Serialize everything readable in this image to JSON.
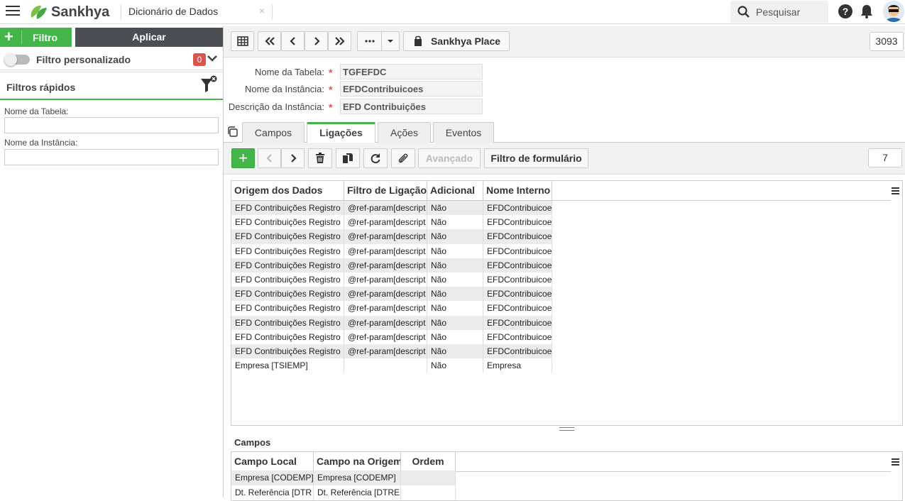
{
  "header": {
    "brand": "Sankhya",
    "title": "Dicionário de Dados",
    "close": "×",
    "search_placeholder": "Pesquisar",
    "help": "?"
  },
  "left": {
    "filtro_label": "Filtro",
    "aplicar_label": "Aplicar",
    "filtro_personalizado": "Filtro personalizado",
    "badge_count": "0",
    "filtros_rapidos": "Filtros rápidos",
    "fields": [
      {
        "label": "Nome da Tabela:",
        "value": ""
      },
      {
        "label": "Nome da Instância:",
        "value": ""
      }
    ]
  },
  "toolbar": {
    "place_label": "Sankhya Place",
    "record_count": "3093"
  },
  "form": {
    "fields": [
      {
        "label": "Nome da Tabela:",
        "value": "TGFEFDC"
      },
      {
        "label": "Nome da Instância:",
        "value": "EFDContribuicoes"
      },
      {
        "label": "Descrição da Instância:",
        "value": "EFD Contribuições"
      }
    ]
  },
  "tabs": [
    "Campos",
    "Ligações",
    "Ações",
    "Eventos"
  ],
  "active_tab": "Ligações",
  "subtoolbar": {
    "avancado": "Avançado",
    "filtro_formulario": "Filtro de formulário",
    "count": "7"
  },
  "grid": {
    "headers": [
      "Origem dos Dados",
      "Filtro de Ligação",
      "Adicional",
      "Nome Interno"
    ],
    "rows": [
      [
        "EFD Contribuições Registro",
        "@ref-param[descript",
        "Não",
        "EFDContribuicoe"
      ],
      [
        "EFD Contribuições Registro",
        "@ref-param[descript",
        "Não",
        "EFDContribuicoe"
      ],
      [
        "EFD Contribuições Registro",
        "@ref-param[descript",
        "Não",
        "EFDContribuicoe"
      ],
      [
        "EFD Contribuições Registro",
        "@ref-param[descript",
        "Não",
        "EFDContribuicoe"
      ],
      [
        "EFD Contribuições Registro",
        "@ref-param[descript",
        "Não",
        "EFDContribuicoe"
      ],
      [
        "EFD Contribuições Registro",
        "@ref-param[descript",
        "Não",
        "EFDContribuicoe"
      ],
      [
        "EFD Contribuições Registro",
        "@ref-param[descript",
        "Não",
        "EFDContribuicoe"
      ],
      [
        "EFD Contribuições Registro",
        "@ref-param[descript",
        "Não",
        "EFDContribuicoe"
      ],
      [
        "EFD Contribuições Registro",
        "@ref-param[descript",
        "Não",
        "EFDContribuicoe"
      ],
      [
        "EFD Contribuições Registro",
        "@ref-param[descript",
        "Não",
        "EFDContribuicoe"
      ],
      [
        "EFD Contribuições Registro",
        "@ref-param[descript",
        "Não",
        "EFDContribuicoe"
      ],
      [
        "Empresa [TSIEMP]",
        "",
        "Não",
        "Empresa"
      ]
    ]
  },
  "campos": {
    "title": "Campos",
    "headers": [
      "Campo Local",
      "Campo na Origem",
      "Ordem"
    ],
    "rows": [
      [
        "Empresa [CODEMP]",
        "Empresa [CODEMP]",
        ""
      ],
      [
        "Dt. Referência [DTR",
        "Dt. Referência [DTRE",
        ""
      ]
    ]
  },
  "colors": {
    "accent": "#44b649",
    "dark_button": "#4b4f54",
    "badge": "#d9534f"
  }
}
